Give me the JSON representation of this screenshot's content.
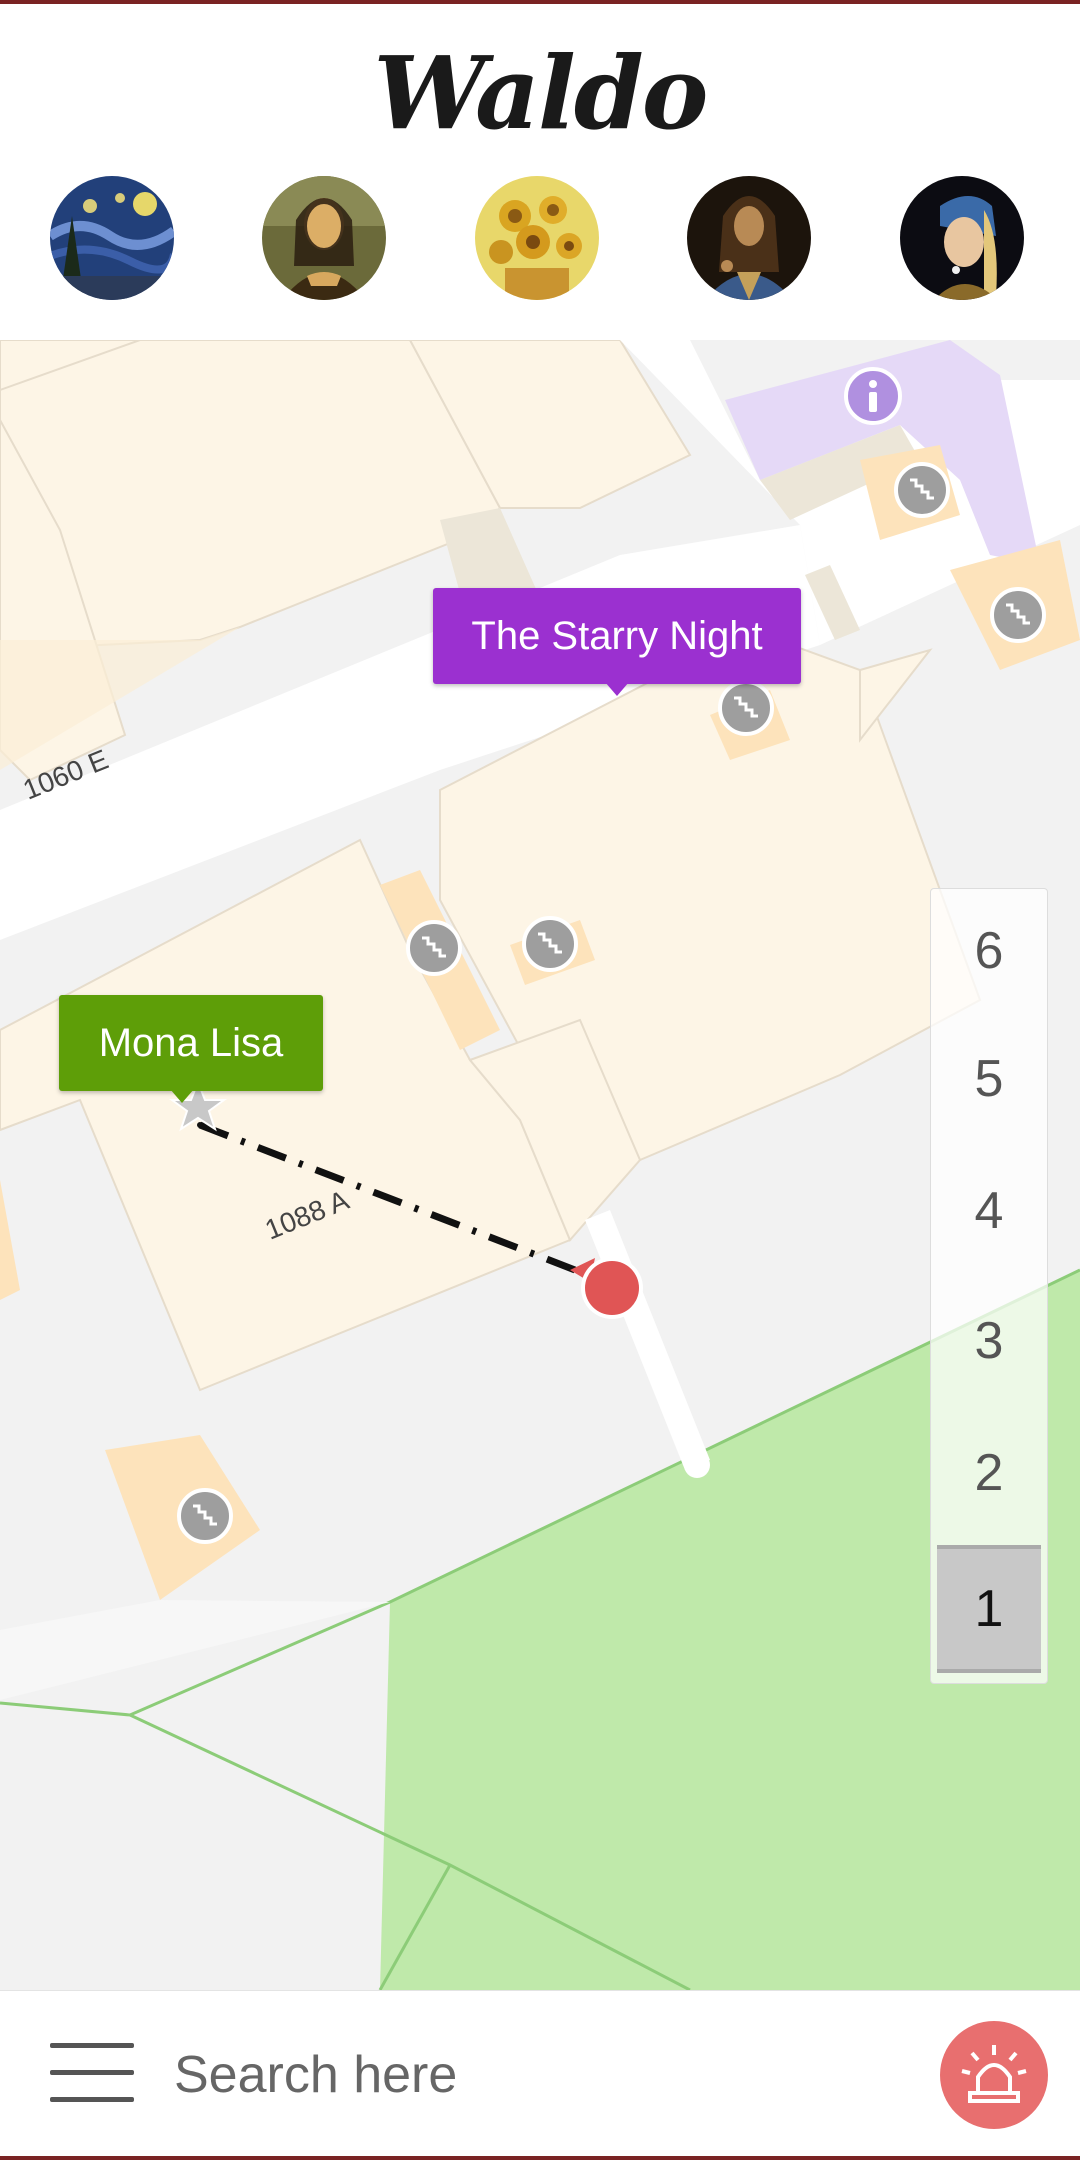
{
  "app": {
    "title": "Waldo"
  },
  "artworks": [
    {
      "name": "The Starry Night",
      "icon": "starry-night-thumbnail"
    },
    {
      "name": "Mona Lisa",
      "icon": "mona-lisa-thumbnail"
    },
    {
      "name": "Sunflowers",
      "icon": "sunflowers-thumbnail"
    },
    {
      "name": "Salvator Mundi",
      "icon": "salvator-mundi-thumbnail"
    },
    {
      "name": "Girl with a Pearl Earring",
      "icon": "pearl-earring-thumbnail"
    }
  ],
  "map": {
    "room_labels": [
      "1060 E",
      "1088 A"
    ],
    "markers": {
      "starry_night": "The Starry Night",
      "mona_lisa": "Mona Lisa"
    },
    "icons": [
      "stairs-icon",
      "info-icon",
      "location-dot-icon",
      "star-icon"
    ]
  },
  "floors": {
    "levels": [
      "6",
      "5",
      "4",
      "3",
      "2",
      "1"
    ],
    "selected": "1"
  },
  "search": {
    "placeholder": "Search here"
  },
  "colors": {
    "accent": "#7a2323",
    "starry_label": "#9b30d0",
    "mona_label": "#5e9e08",
    "user_location": "#e05555",
    "alert": "#e86f6f",
    "park": "#bfe9aa",
    "room": "#fdf5e6"
  }
}
